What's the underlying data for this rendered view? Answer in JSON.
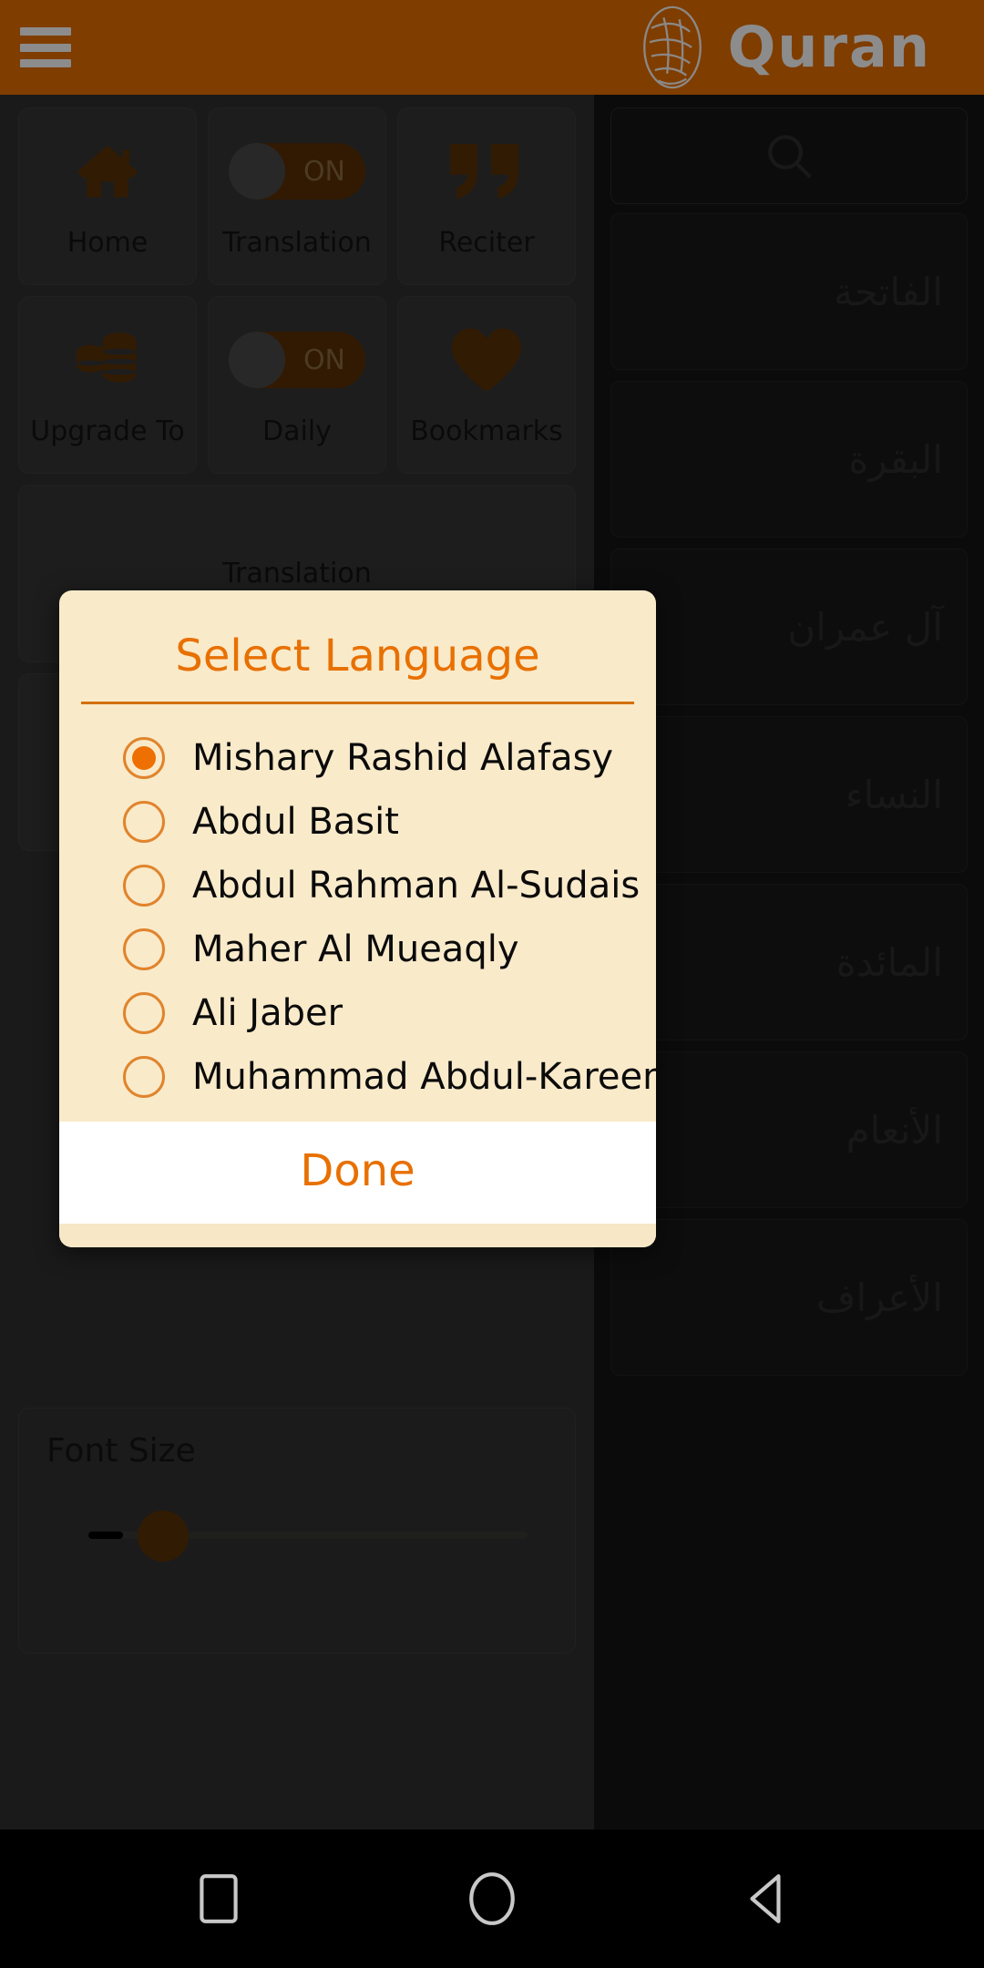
{
  "app": {
    "title": "Quran",
    "accent_orange": "#E87000",
    "dialog_bg": "#F9EACA",
    "menu_icon": "hamburger-menu-icon",
    "logo_icon": "quran-calligraphy-icon"
  },
  "drawer": {
    "tiles": [
      {
        "label": "Home",
        "icon": "home-icon",
        "type": "icon"
      },
      {
        "label": "Translation",
        "icon": "toggle-switch-icon",
        "type": "toggle",
        "state": "ON"
      },
      {
        "label": "Reciter",
        "icon": "quote-icon",
        "type": "icon"
      },
      {
        "label": "Upgrade To",
        "icon": "coins-icon",
        "type": "icon"
      },
      {
        "label": "Daily",
        "icon": "toggle-switch-icon",
        "type": "toggle",
        "state": "ON"
      },
      {
        "label": "Bookmarks",
        "icon": "heart-icon",
        "type": "icon"
      }
    ],
    "translation_card_label": "Translation",
    "font_size": {
      "label": "Font Size",
      "value_percent": 10
    }
  },
  "surah_panel": {
    "search_icon": "search-icon",
    "items": [
      {
        "name": "الفاتحة"
      },
      {
        "name": "البقرة"
      },
      {
        "name": "آل عمران"
      },
      {
        "name": "النساء"
      },
      {
        "name": "المائدة"
      },
      {
        "name": "الأنعام"
      },
      {
        "name": "الأعراف"
      }
    ]
  },
  "dialog": {
    "title": "Select Language",
    "done_label": "Done",
    "selected_index": 0,
    "options": [
      {
        "label": "Mishary Rashid Alafasy",
        "selected": true
      },
      {
        "label": "Abdul Basit",
        "selected": false
      },
      {
        "label": "Abdul Rahman Al-Sudais",
        "selected": false
      },
      {
        "label": "Maher Al Mueaqly",
        "selected": false
      },
      {
        "label": "Ali Jaber",
        "selected": false
      },
      {
        "label": "Muhammad Abdul-Kareem",
        "selected": false
      }
    ]
  },
  "navbar": {
    "buttons": [
      {
        "name": "recent-apps-button",
        "icon": "square-icon"
      },
      {
        "name": "home-button",
        "icon": "circle-icon"
      },
      {
        "name": "back-button",
        "icon": "triangle-left-icon"
      }
    ]
  }
}
